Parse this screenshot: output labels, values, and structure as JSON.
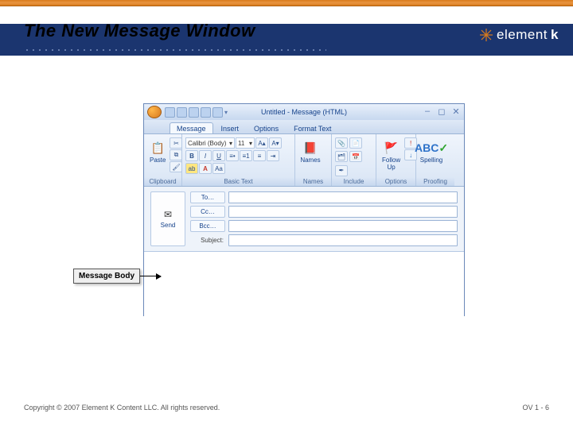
{
  "slide": {
    "title": "The New Message Window",
    "callout_text": "Message Body",
    "copyright": "Copyright © 2007 Element K Content LLC. All rights reserved.",
    "page_ref": "OV 1 - 6",
    "brand": "element",
    "brand_suffix": "k"
  },
  "outlook": {
    "window_title": "Untitled - Message (HTML)",
    "tabs": [
      "Message",
      "Insert",
      "Options",
      "Format Text"
    ],
    "active_tab_index": 0,
    "groups": {
      "clipboard": {
        "label": "Clipboard",
        "paste": "Paste"
      },
      "basic_text": {
        "label": "Basic Text",
        "font_name": "Calibri (Body)",
        "font_size": "11"
      },
      "names": {
        "label": "Names",
        "btn": "Names"
      },
      "include": {
        "label": "Include"
      },
      "options": {
        "label": "Options",
        "followup": "Follow Up"
      },
      "proofing": {
        "label": "Proofing",
        "spelling": "Spelling"
      }
    },
    "fields": {
      "send": "Send",
      "to": "To…",
      "cc": "Cc…",
      "bcc": "Bcc…",
      "subject": "Subject:"
    }
  }
}
